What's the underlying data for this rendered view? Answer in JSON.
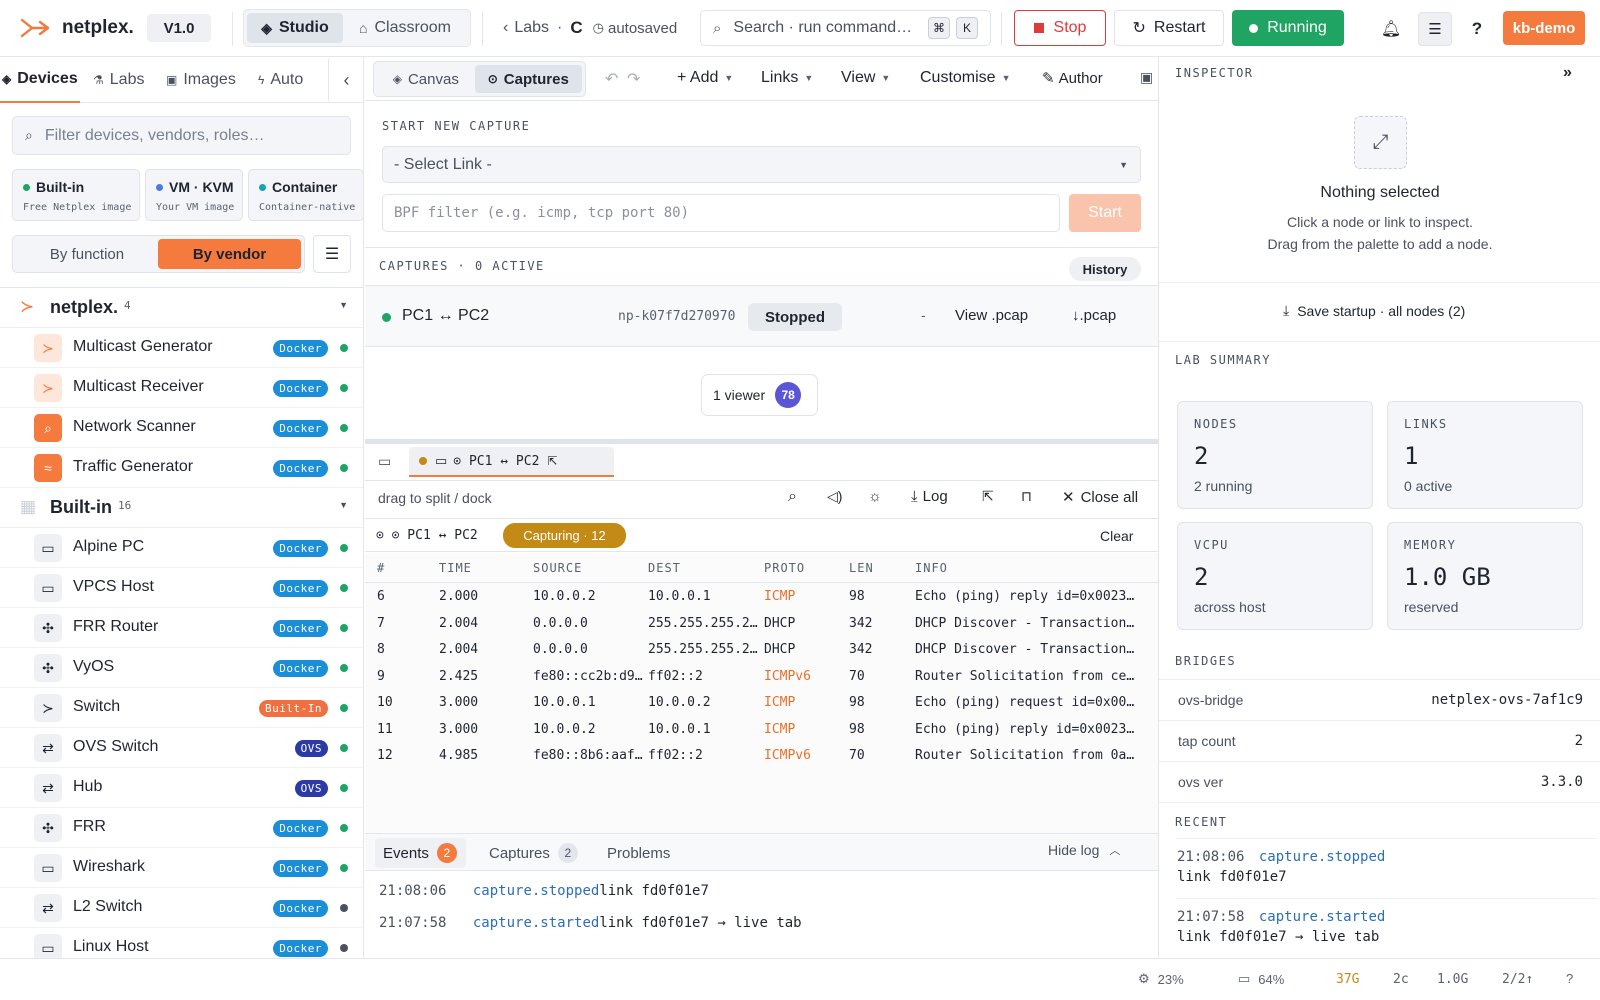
{
  "app": {
    "name": "netplex.",
    "version": "V1.0",
    "mode_studio": "Studio",
    "mode_classroom": "Classroom",
    "breadcrumb_labs": "Labs",
    "breadcrumb_sep": "·",
    "breadcrumb_lab": "C",
    "autosaved": "autosaved",
    "search_placeholder": "Search · run command…",
    "kbd1": "⌘",
    "kbd2": "K",
    "stop": "Stop",
    "restart": "Restart",
    "running": "Running",
    "user": "kb-demo"
  },
  "sidebar": {
    "tabs": [
      "Devices",
      "Labs",
      "Images",
      "Auto"
    ],
    "filter_placeholder": "Filter devices, vendors, roles…",
    "sources": [
      {
        "title": "Built-in",
        "sub": "Free Netplex image",
        "color": "#1fa463"
      },
      {
        "title": "VM · KVM",
        "sub": "Your VM image",
        "color": "#4a7be0"
      },
      {
        "title": "Container",
        "sub": "Container-native",
        "color": "#17a2b8"
      }
    ],
    "group_by_function": "By function",
    "group_by_vendor": "By vendor",
    "groups": [
      {
        "name": "netplex.",
        "count": "4",
        "items": [
          {
            "name": "Multicast Generator",
            "tag": "Docker",
            "kind": "docker",
            "dot": "#1fa463"
          },
          {
            "name": "Multicast Receiver",
            "tag": "Docker",
            "kind": "docker",
            "dot": "#1fa463"
          },
          {
            "name": "Network Scanner",
            "tag": "Docker",
            "kind": "docker",
            "dot": "#1fa463"
          },
          {
            "name": "Traffic Generator",
            "tag": "Docker",
            "kind": "docker",
            "dot": "#1fa463"
          }
        ]
      },
      {
        "name": "Built-in",
        "count": "16",
        "items": [
          {
            "name": "Alpine PC",
            "tag": "Docker",
            "kind": "docker",
            "dot": "#1fa463"
          },
          {
            "name": "VPCS Host",
            "tag": "Docker",
            "kind": "docker",
            "dot": "#1fa463"
          },
          {
            "name": "FRR Router",
            "tag": "Docker",
            "kind": "docker",
            "dot": "#1fa463"
          },
          {
            "name": "VyOS",
            "tag": "Docker",
            "kind": "docker",
            "dot": "#1fa463"
          },
          {
            "name": "Switch",
            "tag": "Built-In",
            "kind": "builtin",
            "dot": "#1fa463"
          },
          {
            "name": "OVS Switch",
            "tag": "OVS",
            "kind": "ovs",
            "dot": "#1fa463"
          },
          {
            "name": "Hub",
            "tag": "OVS",
            "kind": "ovs",
            "dot": "#1fa463"
          },
          {
            "name": "FRR",
            "tag": "Docker",
            "kind": "docker",
            "dot": "#1fa463"
          },
          {
            "name": "Wireshark",
            "tag": "Docker",
            "kind": "docker",
            "dot": "#1fa463"
          },
          {
            "name": "L2 Switch",
            "tag": "Docker",
            "kind": "docker",
            "dot": "#4a5160"
          },
          {
            "name": "Linux Host",
            "tag": "Docker",
            "kind": "docker",
            "dot": "#4a5160"
          }
        ]
      }
    ]
  },
  "toolbar": {
    "canvas": "Canvas",
    "captures": "Captures",
    "add": "+ Add",
    "links": "Links",
    "view": "View",
    "customise": "Customise",
    "author": "Author"
  },
  "capture": {
    "heading": "START NEW CAPTURE",
    "select_placeholder": "- Select Link -",
    "bpf_placeholder": "BPF filter (e.g. icmp, tcp port 80)",
    "start": "Start",
    "list_heading": "CAPTURES · 0 ACTIVE",
    "history": "History",
    "row": {
      "name": "PC1 ↔ PC2",
      "id": "np-k07f7d270970",
      "state": "Stopped",
      "dash": "-",
      "view": "View .pcap",
      "download": "↓.pcap"
    },
    "viewers": "1 viewer",
    "viewer_avatar": "78"
  },
  "term": {
    "tab": "⊙ PC1 ↔ PC2",
    "hint": "drag to split / dock",
    "log": "Log",
    "close_all": "Close all",
    "title": "⊙ ⊙ PC1 ↔ PC2",
    "capturing": "Capturing · 12",
    "clear": "Clear",
    "columns": [
      "#",
      "TIME",
      "SOURCE",
      "DEST",
      "PROTO",
      "LEN",
      "INFO"
    ],
    "rows": [
      [
        "6",
        "2.000",
        "10.0.0.2",
        "10.0.0.1",
        "ICMP",
        "98",
        "Echo (ping) reply id=0x0023…"
      ],
      [
        "7",
        "2.004",
        "0.0.0.0",
        "255.255.255.2…",
        "DHCP",
        "342",
        "DHCP Discover - Transaction…"
      ],
      [
        "8",
        "2.004",
        "0.0.0.0",
        "255.255.255.2…",
        "DHCP",
        "342",
        "DHCP Discover - Transaction…"
      ],
      [
        "9",
        "2.425",
        "fe80::cc2b:d9…",
        "ff02::2",
        "ICMPv6",
        "70",
        "Router Solicitation from ce…"
      ],
      [
        "10",
        "3.000",
        "10.0.0.1",
        "10.0.0.2",
        "ICMP",
        "98",
        "Echo (ping) request id=0x00…"
      ],
      [
        "11",
        "3.000",
        "10.0.0.2",
        "10.0.0.1",
        "ICMP",
        "98",
        "Echo (ping) reply id=0x0023…"
      ],
      [
        "12",
        "4.985",
        "fe80::8b6:aaf…",
        "ff02::2",
        "ICMPv6",
        "70",
        "Router Solicitation from 0a…"
      ]
    ]
  },
  "log": {
    "tabs": [
      {
        "label": "Events",
        "count": "2"
      },
      {
        "label": "Captures",
        "count": "2"
      },
      {
        "label": "Problems",
        "count": ""
      }
    ],
    "hide": "Hide log",
    "entries": [
      {
        "time": "21:08:06",
        "event": "capture.stopped",
        "detail": "link fd0f01e7"
      },
      {
        "time": "21:07:58",
        "event": "capture.started",
        "detail": "link fd0f01e7 → live tab"
      }
    ]
  },
  "inspector": {
    "title": "INSPECTOR",
    "collapse": "»",
    "nothing": "Nothing selected",
    "hint1": "Click a node or link to inspect.",
    "hint2": "Drag from the palette to add a node.",
    "save": "Save startup · all nodes (2)",
    "summary_title": "LAB SUMMARY",
    "cards": [
      {
        "label": "NODES",
        "value": "2",
        "sub": "2 running"
      },
      {
        "label": "LINKS",
        "value": "1",
        "sub": "0 active"
      },
      {
        "label": "VCPU",
        "value": "2",
        "sub": "across host"
      },
      {
        "label": "MEMORY",
        "value": "1.0 GB",
        "sub": "reserved"
      }
    ],
    "bridges_title": "BRIDGES",
    "bridges": [
      {
        "k": "ovs-bridge",
        "v": "netplex-ovs-7af1c9"
      },
      {
        "k": "tap count",
        "v": "2"
      },
      {
        "k": "ovs ver",
        "v": "3.3.0"
      }
    ],
    "recent_title": "RECENT",
    "recent": [
      {
        "time": "21:08:06",
        "event": "capture.stopped",
        "detail": "link fd0f01e7"
      },
      {
        "time": "21:07:58",
        "event": "capture.started",
        "detail": "link fd0f01e7 → live tab"
      }
    ]
  },
  "status": {
    "cpu": "23%",
    "mem": "64%",
    "disk": "37G",
    "cores": "2c",
    "ram": "1.0G",
    "nodes": "2/2↑",
    "help": "?"
  },
  "colors": {
    "accent": "#f47a3d",
    "running": "#1fa463",
    "stop": "#e03a3a",
    "link": "#2b6fb8",
    "proto": "#e8702a",
    "capturing": "#c48a16"
  }
}
